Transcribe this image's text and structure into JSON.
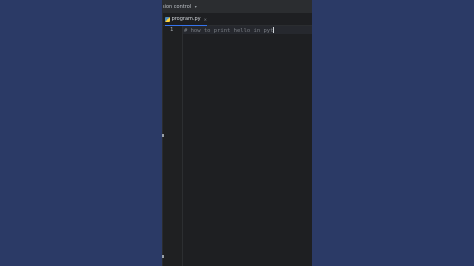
{
  "titlebar": {
    "vcs_label": "sion control",
    "vcs_chevron": "chevron-down-icon"
  },
  "tab": {
    "icon": "python-file-icon",
    "filename": "program.py",
    "close": "close-icon"
  },
  "editor": {
    "line_numbers": [
      "1"
    ],
    "lines": [
      "# how to print hello in pyt"
    ]
  },
  "colors": {
    "background": "#2b3a66",
    "editor_bg": "#1e1f22",
    "comment": "#7a7e85",
    "tab_accent": "#3574f0"
  }
}
